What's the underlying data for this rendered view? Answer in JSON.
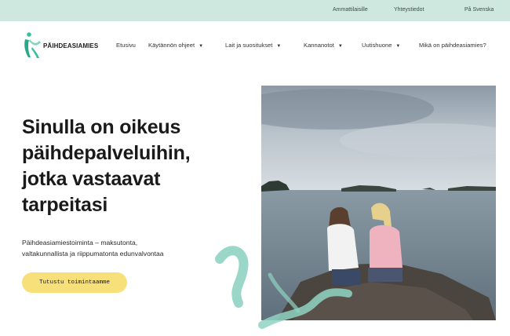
{
  "topbar": {
    "links": [
      "Ammattilaisille",
      "Yhteystiedot",
      "På Svenska"
    ],
    "color": "#cfe8df"
  },
  "logo": {
    "text": "PÄIHDEASIAMIES",
    "icon": "figure-logo-icon"
  },
  "nav": {
    "items": [
      {
        "label": "Etusivu",
        "dropdown": false
      },
      {
        "label": "Käytännön ohjeet",
        "dropdown": true
      },
      {
        "label": "Lait ja suositukset",
        "dropdown": true
      },
      {
        "label": "Kannanotot",
        "dropdown": true
      },
      {
        "label": "Uutishuone",
        "dropdown": true
      },
      {
        "label": "Mikä on päihdeasiamies?",
        "dropdown": false
      }
    ]
  },
  "hero": {
    "title_lines": [
      "Sinulla on oikeus",
      "päihdepalveluihin,",
      "jotka vastaavat",
      "tarpeitasi"
    ],
    "subtitle_lines": [
      "Päihdeasiamiestoiminta – maksutonta,",
      "valtakunnallista ja riippumatonta edunvalvontaa"
    ],
    "cta_label": "Tutustu toimintaamme",
    "cta_color": "#f7e07a",
    "accent_color": "#8fd3c2"
  }
}
